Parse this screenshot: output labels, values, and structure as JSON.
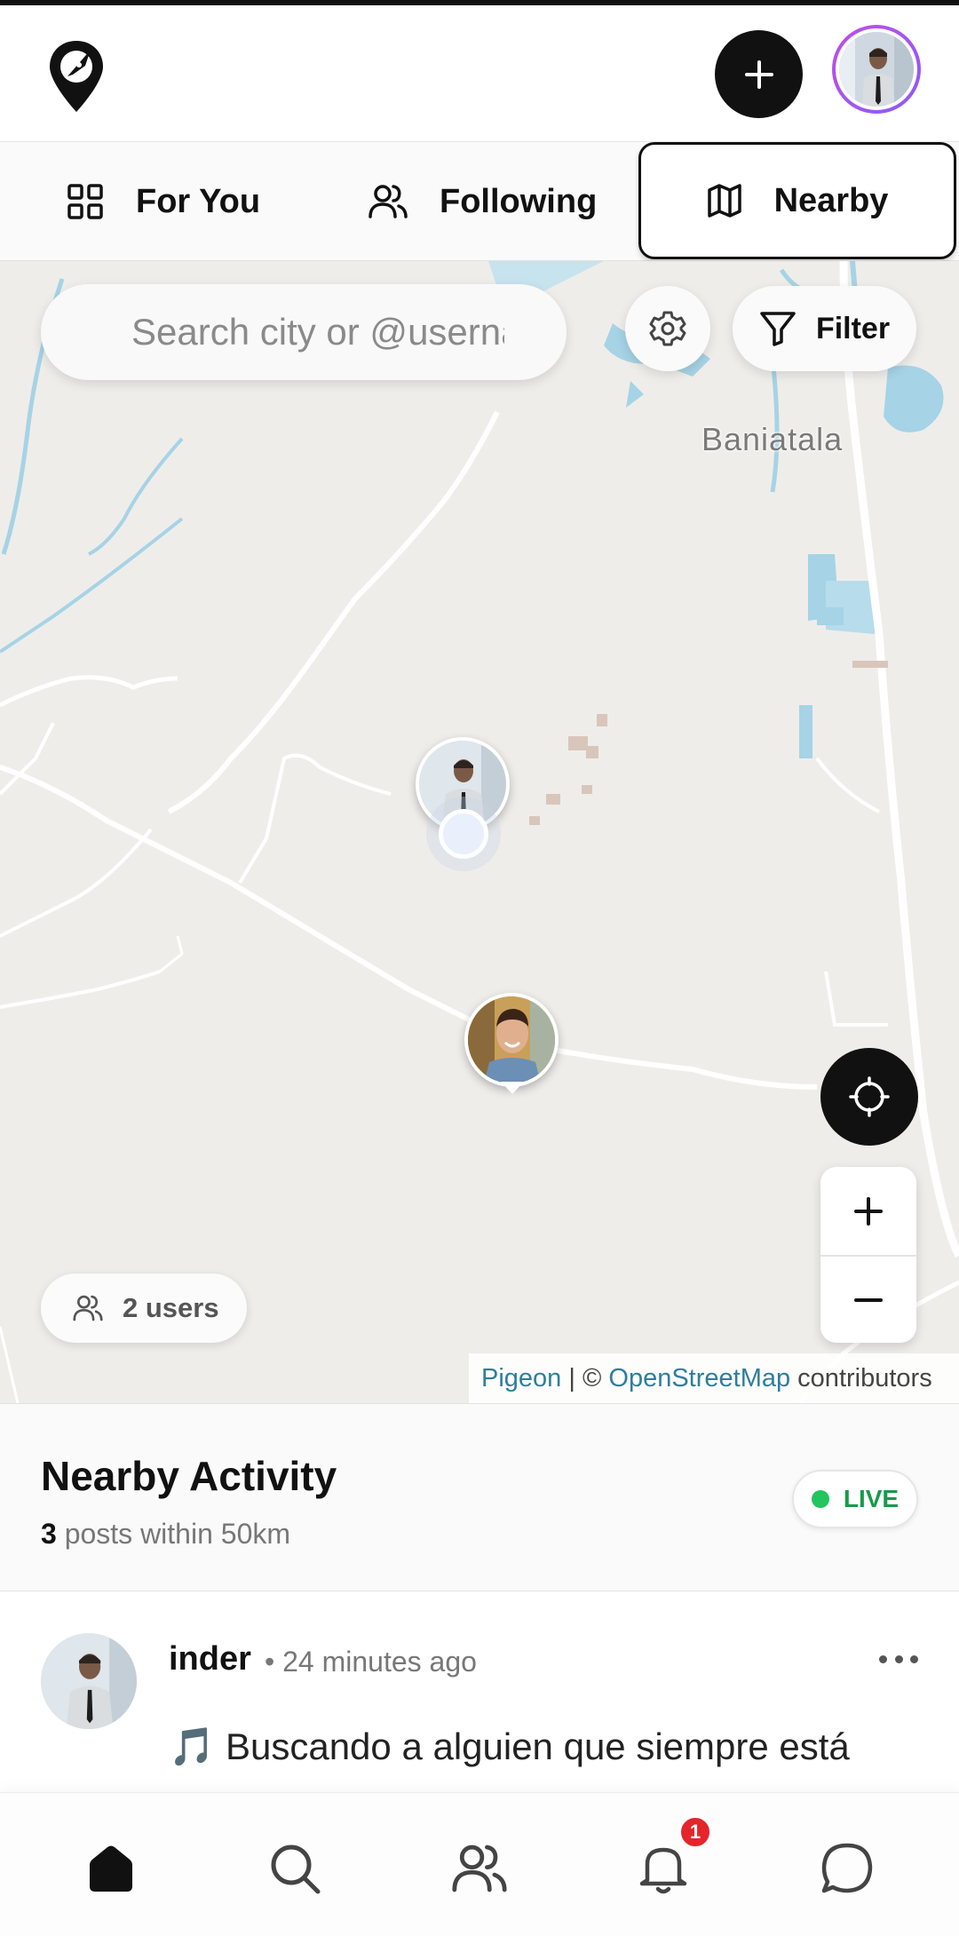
{
  "header": {
    "logo_icon": "location-pin-compass-icon",
    "create_icon": "plus-icon",
    "avatar_alt": "profile avatar"
  },
  "tabs": [
    {
      "label": "For You",
      "icon": "grid-icon",
      "active": false
    },
    {
      "label": "Following",
      "icon": "users-icon",
      "active": false
    },
    {
      "label": "Nearby",
      "icon": "map-icon",
      "active": true
    }
  ],
  "map": {
    "search_placeholder": "Search city or @username",
    "filter_label": "Filter",
    "place_label": "Baniatala",
    "users_count_label": "2 users",
    "attribution": {
      "link1": "Pigeon",
      "sep": " | © ",
      "link2": "OpenStreetMap",
      "suffix": " contributors"
    },
    "colors": {
      "land": "#efedea",
      "water": "#a6d3e6",
      "road": "#ffffff"
    }
  },
  "activity": {
    "title": "Nearby Activity",
    "count": "3",
    "subtitle": " posts within 50km",
    "live_label": "LIVE"
  },
  "post": {
    "username": "inder",
    "time": "• 24 minutes ago",
    "text": "🎵 Buscando a alguien que siempre está"
  },
  "bottom_nav": {
    "items": [
      "home-icon",
      "search-icon",
      "people-icon",
      "bell-icon",
      "chat-icon"
    ],
    "notification_count": "1",
    "badge_color": "#e5252a"
  }
}
